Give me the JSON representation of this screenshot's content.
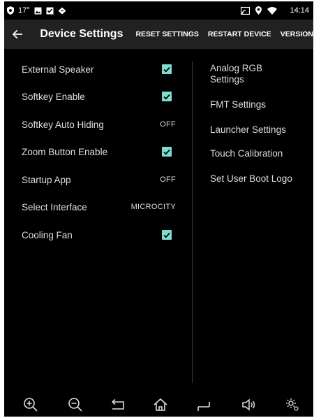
{
  "status_bar": {
    "temperature": "17°",
    "time": "14:14"
  },
  "app_bar": {
    "title": "Device Settings",
    "actions": {
      "reset": "RESET SETTINGS",
      "restart": "RESTART DEVICE",
      "version": "VERSION"
    }
  },
  "left_settings": [
    {
      "label": "External Speaker",
      "control": "checkbox",
      "checked": true
    },
    {
      "label": "Softkey Enable",
      "control": "checkbox",
      "checked": true
    },
    {
      "label": "Softkey Auto Hiding",
      "control": "value",
      "value": "OFF"
    },
    {
      "label": "Zoom Button Enable",
      "control": "checkbox",
      "checked": true
    },
    {
      "label": "Startup App",
      "control": "value",
      "value": "OFF"
    },
    {
      "label": "Select Interface",
      "control": "value",
      "value": "MICROCITY"
    },
    {
      "label": "Cooling Fan",
      "control": "checkbox",
      "checked": true
    }
  ],
  "right_settings": [
    {
      "label": "Analog RGB Settings"
    },
    {
      "label": "FMT Settings"
    },
    {
      "label": "Launcher Settings"
    },
    {
      "label": "Touch Calibration"
    },
    {
      "label": "Set User Boot Logo"
    }
  ],
  "colors": {
    "accent": "#7fdcd0",
    "app_bar": "#212121",
    "background": "#000000"
  },
  "icons": {
    "status": [
      "shield-icon",
      "image-icon",
      "check-box-icon",
      "diamond-icon",
      "cast-icon",
      "location-icon",
      "wifi-icon"
    ],
    "bottom_nav": [
      "zoom-in-icon",
      "zoom-out-icon",
      "back-icon",
      "home-icon",
      "recent-apps-icon",
      "volume-icon",
      "settings-icon"
    ]
  }
}
